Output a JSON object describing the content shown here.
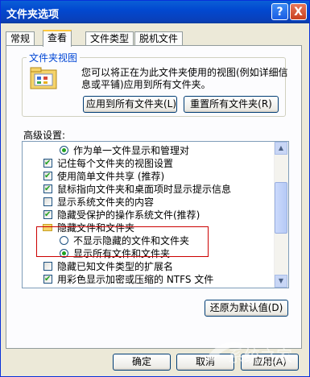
{
  "window": {
    "title": "文件夹选项"
  },
  "titlebar": {
    "help": "?",
    "close": "X"
  },
  "tabs": [
    {
      "label": "常规"
    },
    {
      "label": "查看"
    },
    {
      "label": "文件类型"
    },
    {
      "label": "脱机文件"
    }
  ],
  "folder_views": {
    "label": "文件夹视图",
    "description": "您可以将正在为此文件夹使用的视图(例如详细信息或平铺)应用到所有文件夹。",
    "apply_all_label": "应用到所有文件夹(L)",
    "reset_all_label": "重置所有文件夹(R)"
  },
  "advanced": {
    "label": "高级设置:",
    "items": [
      {
        "text": "作为单一文件显示和管理对",
        "type": "radio",
        "checked": true
      },
      {
        "text": "记住每个文件夹的视图设置",
        "type": "checkbox",
        "checked": true
      },
      {
        "text": "使用简单文件共享 (推荐)",
        "type": "checkbox",
        "checked": true
      },
      {
        "text": "鼠标指向文件夹和桌面项时显示提示信息",
        "type": "checkbox",
        "checked": true
      },
      {
        "text": "显示系统文件夹的内容",
        "type": "checkbox",
        "checked": false
      },
      {
        "text": "隐藏受保护的操作系统文件(推荐)",
        "type": "checkbox",
        "checked": true
      },
      {
        "text": "隐藏文件和文件夹",
        "type": "folder"
      },
      {
        "text": "不显示隐藏的文件和文件夹",
        "type": "radio",
        "checked": false
      },
      {
        "text": "显示所有文件和文件夹",
        "type": "radio",
        "checked": true
      },
      {
        "text": "隐藏已知文件类型的扩展名",
        "type": "checkbox",
        "checked": false
      },
      {
        "text": "用彩色显示加密或压缩的 NTFS 文件",
        "type": "checkbox",
        "checked": true
      }
    ]
  },
  "restore_defaults_label": "还原为默认值(D)",
  "footer": {
    "ok_label": "确定",
    "cancel_label": "取消",
    "apply_label": "应用(A)"
  },
  "colors": {
    "titlebar": "#0a5fd6",
    "dialog": "#ece9d8",
    "highlight_box": "#cc0000",
    "check": "#21a121"
  }
}
